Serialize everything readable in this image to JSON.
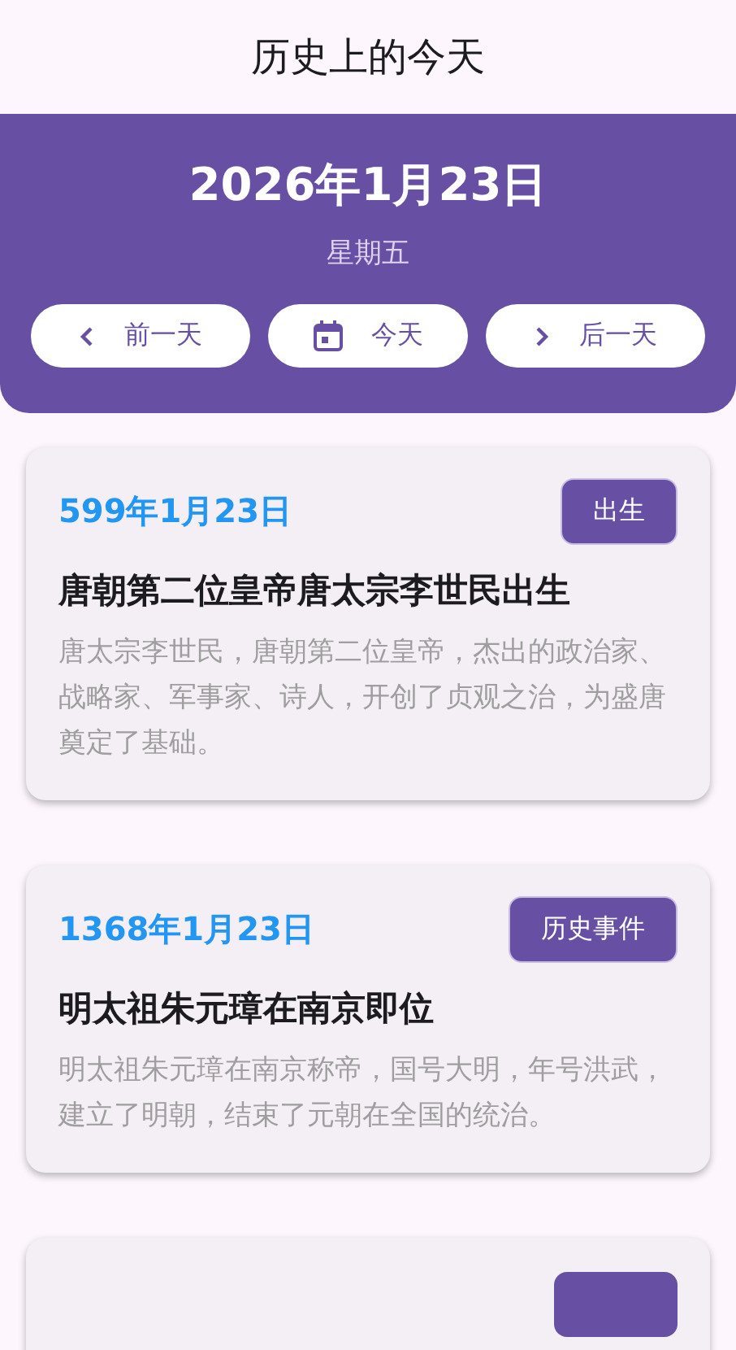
{
  "app_bar": {
    "title": "历史上的今天"
  },
  "header": {
    "date": "2026年1月23日",
    "weekday": "星期五",
    "buttons": [
      {
        "kind": "prev",
        "label": "前一天"
      },
      {
        "kind": "today",
        "label": "今天"
      },
      {
        "kind": "next",
        "label": "后一天"
      }
    ]
  },
  "events": [
    {
      "date": "599年1月23日",
      "tag": "出生",
      "title": "唐朝第二位皇帝唐太宗李世民出生",
      "description": "唐太宗李世民，唐朝第二位皇帝，杰出的政治家、战略家、军事家、诗人，开创了贞观之治，为盛唐奠定了基础。"
    },
    {
      "date": "1368年1月23日",
      "tag": "历史事件",
      "title": "明太祖朱元璋在南京即位",
      "description": "明太祖朱元璋在南京称帝，国号大明，年号洪武，建立了明朝，结束了元朝在全国的统治。"
    }
  ]
}
